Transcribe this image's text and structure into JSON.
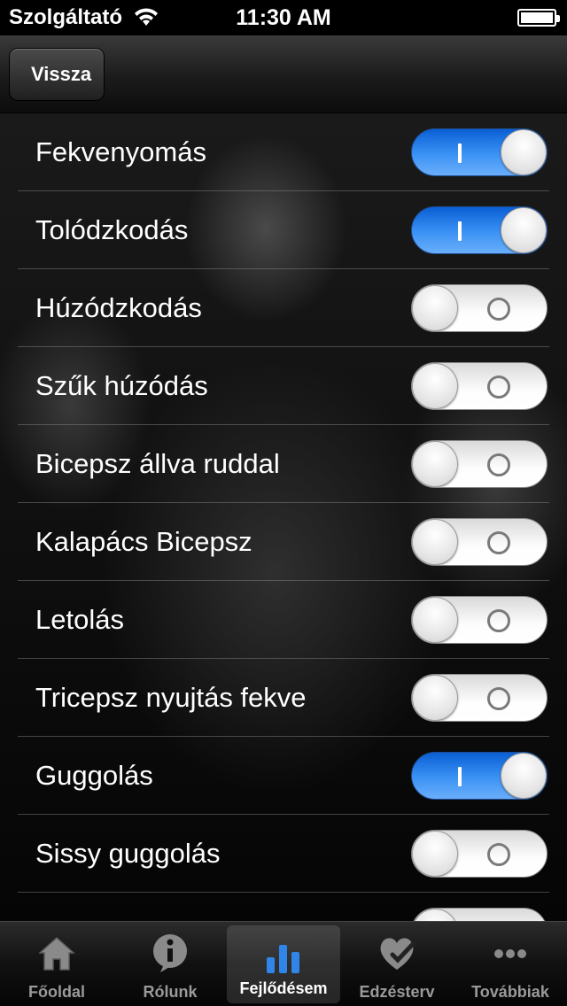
{
  "status_bar": {
    "carrier": "Szolgáltató",
    "time": "11:30 AM"
  },
  "nav": {
    "back_label": "Vissza"
  },
  "exercises": [
    {
      "label": "Fekvenyomás",
      "on": true
    },
    {
      "label": "Tolódzkodás",
      "on": true
    },
    {
      "label": "Húzódzkodás",
      "on": false
    },
    {
      "label": "Szűk húzódás",
      "on": false
    },
    {
      "label": "Bicepsz állva ruddal",
      "on": false
    },
    {
      "label": "Kalapács Bicepsz",
      "on": false
    },
    {
      "label": "Letolás",
      "on": false
    },
    {
      "label": "Tricepsz nyujtás fekve",
      "on": false
    },
    {
      "label": "Guggolás",
      "on": true
    },
    {
      "label": "Sissy guggolás",
      "on": false
    },
    {
      "label": "",
      "on": false
    }
  ],
  "tabs": [
    {
      "label": "Főoldal",
      "icon": "home-icon",
      "active": false
    },
    {
      "label": "Rólunk",
      "icon": "info-icon",
      "active": false
    },
    {
      "label": "Fejlődésem",
      "icon": "bar-chart-icon",
      "active": true
    },
    {
      "label": "Edzésterv",
      "icon": "heart-check-icon",
      "active": false
    },
    {
      "label": "Továbbiak",
      "icon": "more-icon",
      "active": false
    }
  ],
  "colors": {
    "toggle_on": "#3c93f5",
    "tab_active_icon": "#2f86e8"
  }
}
